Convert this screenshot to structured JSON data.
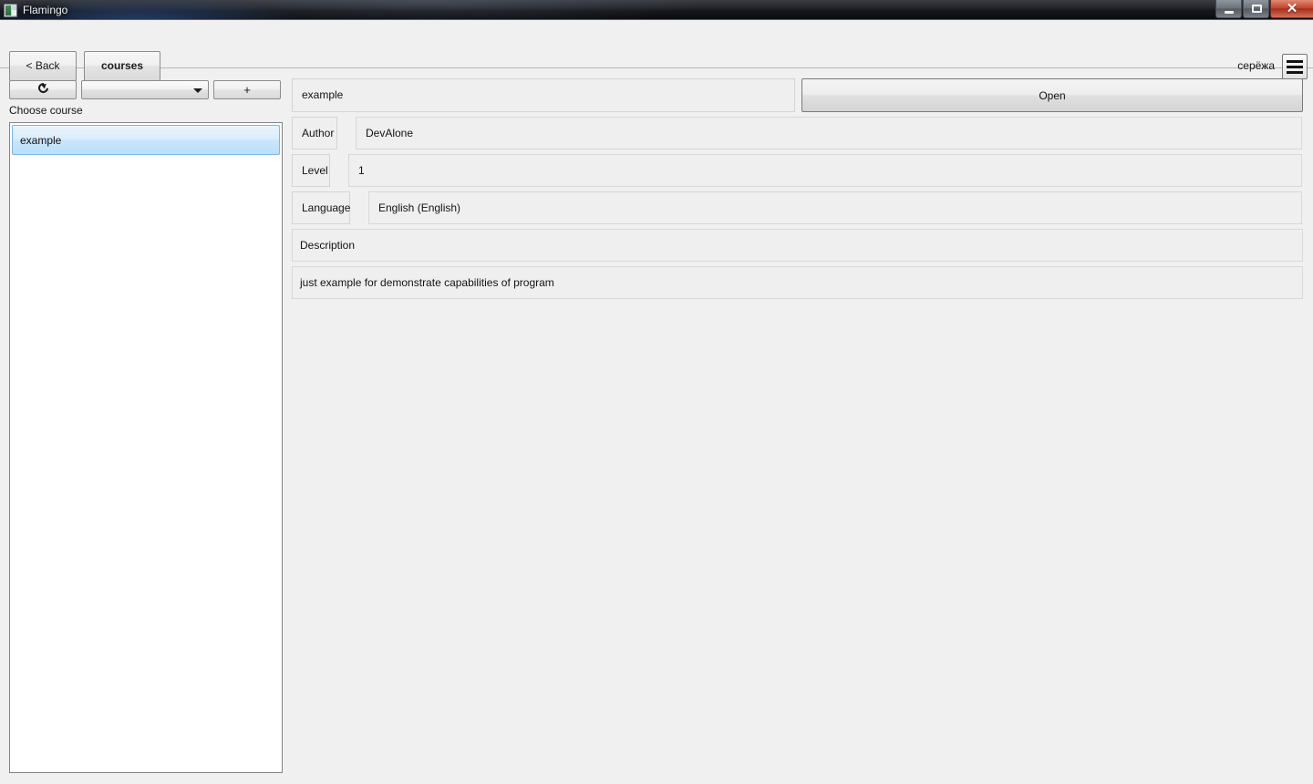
{
  "window": {
    "title": "Flamingo",
    "app_icon": "app-window-icon",
    "controls": {
      "minimize": "minimize-icon",
      "maximize": "restore-icon",
      "close": "✕"
    }
  },
  "toolbar": {
    "back_label": "< Back",
    "section_label": "courses",
    "user_name": "серёжа",
    "menu_icon": "hamburger-menu-icon"
  },
  "left_panel": {
    "refresh_icon": "refresh-icon",
    "refresh_label": "",
    "filter_dropdown": {
      "value": "",
      "arrow_icon": "chevron-down-icon"
    },
    "add_label": "+",
    "choose_label": "Choose course",
    "courses": [
      {
        "name": "example",
        "selected": true
      }
    ]
  },
  "details": {
    "course_name": "example",
    "open_label": "Open",
    "fields": [
      {
        "key": "Author",
        "value": "DevAlone"
      },
      {
        "key": "Level",
        "value": "1"
      },
      {
        "key": "Language",
        "value": "English (English)"
      }
    ],
    "description_header": "Description",
    "description_body": "just example for demonstrate capabilities of program"
  },
  "colors": {
    "window_bg": "#f0f0f0",
    "field_bg": "#efefef",
    "selection_blue": "#cbe6fb",
    "titlebar_dark": "#14151a",
    "close_red": "#c2452c"
  }
}
